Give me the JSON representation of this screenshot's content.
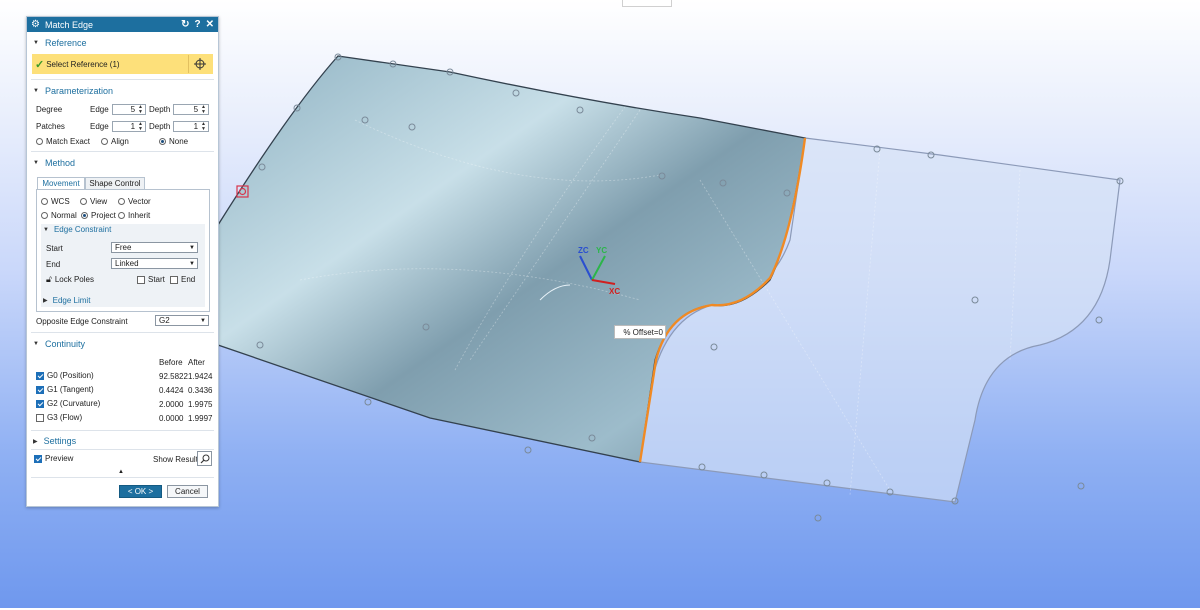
{
  "dialog": {
    "title": "Match Edge",
    "reference": {
      "header": "Reference",
      "select_label": "Select Reference (1)"
    },
    "parameterization": {
      "header": "Parameterization",
      "degree_label": "Degree",
      "patches_label": "Patches",
      "edge_label": "Edge",
      "depth_label": "Depth",
      "degree_edge": "5",
      "degree_depth": "5",
      "patches_edge": "1",
      "patches_depth": "1",
      "options": [
        "Match Exact",
        "Align",
        "None"
      ],
      "selected": "None"
    },
    "method": {
      "header": "Method",
      "tabs": [
        "Movement",
        "Shape Control"
      ],
      "active_tab": "Movement",
      "row1": [
        "WCS",
        "View",
        "Vector"
      ],
      "row2": [
        "Normal",
        "Project",
        "Inherit"
      ],
      "selected": "Project",
      "edge_constraint": {
        "header": "Edge Constraint",
        "start_label": "Start",
        "start_value": "Free",
        "end_label": "End",
        "end_value": "Linked",
        "lock_poles_label": "Lock Poles",
        "start_chk": "Start",
        "end_chk": "End"
      },
      "edge_limit_header": "Edge Limit",
      "opposite_label": "Opposite Edge Constraint",
      "opposite_value": "G2"
    },
    "continuity": {
      "header": "Continuity",
      "col_before": "Before",
      "col_after": "After",
      "rows": [
        {
          "label": "G0 (Position)",
          "before": "92.5822",
          "after": "1.9424",
          "checked": true
        },
        {
          "label": "G1 (Tangent)",
          "before": "0.4424",
          "after": "0.3436",
          "checked": true
        },
        {
          "label": "G2 (Curvature)",
          "before": "2.0000",
          "after": "1.9975",
          "checked": true
        },
        {
          "label": "G3 (Flow)",
          "before": "0.0000",
          "after": "1.9997",
          "checked": false
        }
      ]
    },
    "settings_header": "Settings",
    "preview_label": "Preview",
    "show_result_label": "Show Result",
    "ok_label": "< OK >",
    "cancel_label": "Cancel"
  },
  "viewport": {
    "offset_tooltip": "% Offset=0",
    "axes": {
      "zc": "ZC",
      "yc": "YC",
      "xc": "XC"
    }
  },
  "colors": {
    "title_bar": "#1d6f9f",
    "reference_highlight": "#fde07a",
    "surface": "#7f9fae",
    "preview_surface": "#c9d8f3",
    "edge_highlight": "#f08a24",
    "background_bottom": "#6f98ee"
  }
}
